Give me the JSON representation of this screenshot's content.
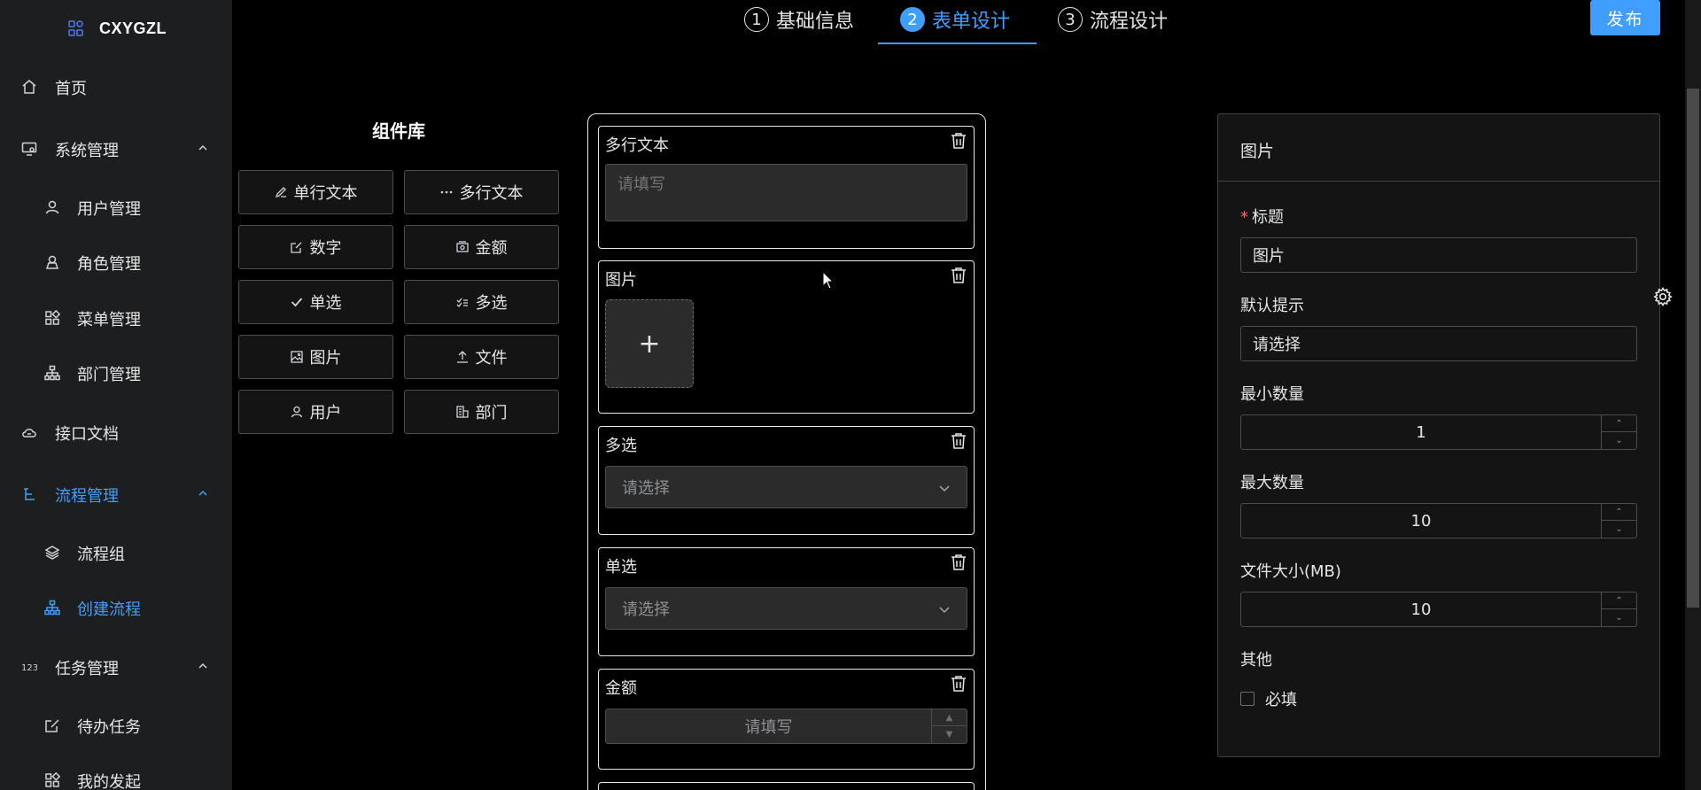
{
  "app": {
    "logo_text": "CXYGZL",
    "logo_icon": "apps-icon"
  },
  "sidebar": {
    "items": [
      {
        "label": "首页",
        "icon": "home-icon",
        "level": 1
      },
      {
        "label": "系统管理",
        "icon": "monitor-icon",
        "level": 1,
        "expanded": true
      },
      {
        "label": "用户管理",
        "icon": "user-icon",
        "level": 2
      },
      {
        "label": "角色管理",
        "icon": "role-icon",
        "level": 2
      },
      {
        "label": "菜单管理",
        "icon": "grid-icon",
        "level": 2
      },
      {
        "label": "部门管理",
        "icon": "org-icon",
        "level": 2
      },
      {
        "label": "接口文档",
        "icon": "cloud-icon",
        "level": 1
      },
      {
        "label": "流程管理",
        "icon": "flow-icon",
        "level": 1,
        "expanded": true,
        "active": true
      },
      {
        "label": "流程组",
        "icon": "layers-icon",
        "level": 2
      },
      {
        "label": "创建流程",
        "icon": "org-icon",
        "level": 2,
        "active": true
      },
      {
        "label": "任务管理",
        "icon": "number-icon",
        "level": 1,
        "expanded": true
      },
      {
        "label": "待办任务",
        "icon": "edit-icon",
        "level": 2
      },
      {
        "label": "我的发起",
        "icon": "grid-icon",
        "level": 2
      }
    ]
  },
  "steps": [
    {
      "num": "1",
      "label": "基础信息"
    },
    {
      "num": "2",
      "label": "表单设计",
      "active": true
    },
    {
      "num": "3",
      "label": "流程设计"
    }
  ],
  "publish_label": "发布",
  "library": {
    "title": "组件库",
    "items": [
      {
        "label": "单行文本",
        "icon": "pen-icon"
      },
      {
        "label": "多行文本",
        "icon": "more-icon"
      },
      {
        "label": "数字",
        "icon": "edit-icon"
      },
      {
        "label": "金额",
        "icon": "money-icon"
      },
      {
        "label": "单选",
        "icon": "check-icon"
      },
      {
        "label": "多选",
        "icon": "multi-check-icon"
      },
      {
        "label": "图片",
        "icon": "picture-icon"
      },
      {
        "label": "文件",
        "icon": "upload-icon"
      },
      {
        "label": "用户",
        "icon": "user-icon"
      },
      {
        "label": "部门",
        "icon": "office-icon"
      }
    ]
  },
  "canvas": {
    "fields": [
      {
        "title": "多行文本",
        "type": "textarea",
        "placeholder": "请填写"
      },
      {
        "title": "图片",
        "type": "upload",
        "glyph": "+"
      },
      {
        "title": "多选",
        "type": "select",
        "placeholder": "请选择"
      },
      {
        "title": "单选",
        "type": "select",
        "placeholder": "请选择"
      },
      {
        "title": "金额",
        "type": "number",
        "placeholder": "请填写"
      }
    ]
  },
  "panel": {
    "title": "图片",
    "title_label": "标题",
    "title_value": "图片",
    "hint_label": "默认提示",
    "hint_value": "请选择",
    "min_label": "最小数量",
    "min_value": "1",
    "max_label": "最大数量",
    "max_value": "10",
    "size_label": "文件大小(MB)",
    "size_value": "10",
    "other_label": "其他",
    "required_label": "必填",
    "required_checked": false
  },
  "colors": {
    "accent": "#409eff",
    "background": "#000000",
    "sidebar": "#1d1e1f",
    "required": "#f56c6c"
  }
}
